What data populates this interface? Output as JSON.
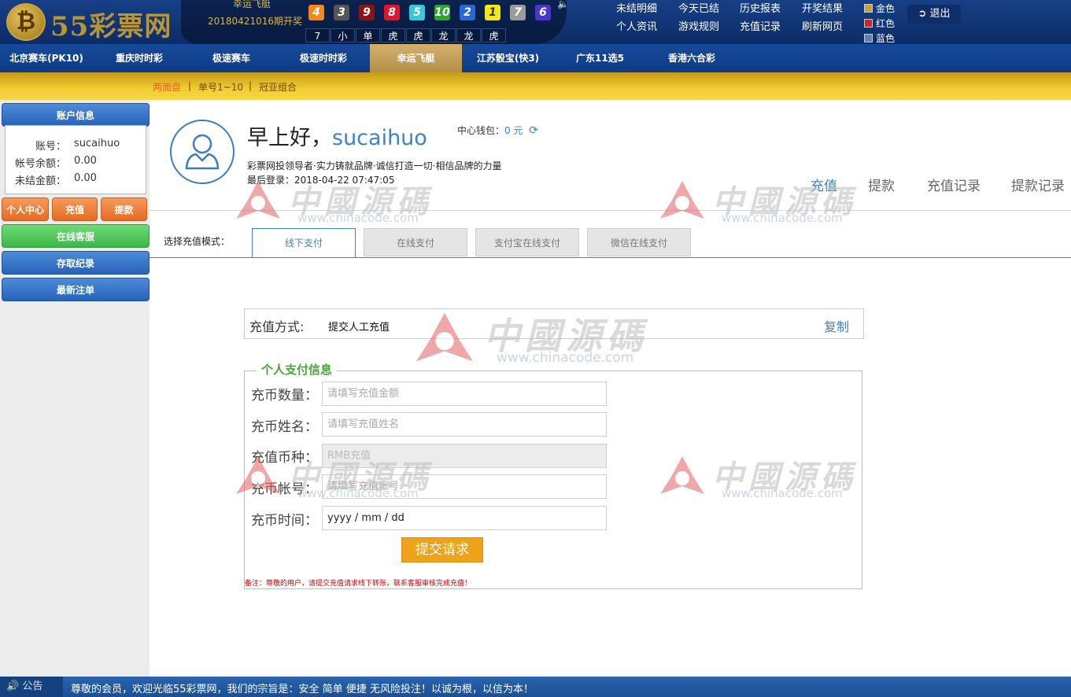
{
  "brand": {
    "logo_text": "55彩票网",
    "coin_glyph": "₿"
  },
  "lottery": {
    "game_name": "幸运飞艇",
    "period": "20180421016期开奖",
    "balls": [
      {
        "n": "4",
        "color": "#f08a1c"
      },
      {
        "n": "3",
        "color": "#555555"
      },
      {
        "n": "9",
        "color": "#8b1515"
      },
      {
        "n": "8",
        "color": "#e0172a"
      },
      {
        "n": "5",
        "color": "#38c7d6"
      },
      {
        "n": "10",
        "color": "#2fa32f"
      },
      {
        "n": "2",
        "color": "#2469d6"
      },
      {
        "n": "1",
        "color": "#f2e61d"
      },
      {
        "n": "7",
        "color": "#9b9b9b"
      },
      {
        "n": "6",
        "color": "#4a34c9"
      }
    ],
    "attrs": [
      "7",
      "小",
      "单",
      "虎",
      "虎",
      "龙",
      "龙",
      "虎"
    ]
  },
  "top_links": {
    "unsettled": "未结明细",
    "today_settled": "今天已结",
    "history": "历史报表",
    "results": "开奖结果",
    "personal_news": "个人资讯",
    "game_rules": "游戏规则",
    "recharge_record": "充值记录",
    "refresh": "刷新网页"
  },
  "theme_legend": [
    {
      "label": "金色",
      "color": "#c9a23a"
    },
    {
      "label": "红色",
      "color": "#d4202a"
    },
    {
      "label": "蓝色",
      "color": "#5f7fb8"
    }
  ],
  "logout_label": "退出",
  "nav": [
    "北京赛车(PK10)",
    "重庆时时彩",
    "极速赛车",
    "极速时时彩",
    "幸运飞艇",
    "江苏骰宝(快3)",
    "广东11选5",
    "香港六合彩"
  ],
  "subnav": [
    "两面盘",
    "单号1~10",
    "冠亚组合"
  ],
  "sidebar": {
    "account_info": "账户信息",
    "account_label": "账号：",
    "account_value": "sucaihuo",
    "balance_label": "帐号余额：",
    "balance_value": "0.00",
    "unsettled_label": "未结金额：",
    "unsettled_value": "0.00",
    "personal_center": "个人中心",
    "recharge": "充值",
    "withdraw": "提款",
    "online_service": "在线客服",
    "deposit_record": "存取纪录",
    "latest_bets": "最新注单"
  },
  "profile": {
    "greeting": "早上好，",
    "username": "sucaihuo",
    "wallet_label": "中心钱包：",
    "wallet_value": "0 元",
    "slogan": "彩票网投领导者·实力铸就品牌·诚信打造一切·相信品牌的力量",
    "last_login": "最后登录：2018-04-22 07:47:05"
  },
  "right_tabs": [
    "充值",
    "提款",
    "充值记录",
    "提款记录"
  ],
  "pay_mode_label": "选择充值模式：",
  "pay_tabs": [
    "线下支付",
    "在线支付",
    "支付宝在线支付",
    "微信在线支付"
  ],
  "method": {
    "label": "充值方式:",
    "value": "提交人工充值",
    "copy": "复制"
  },
  "form": {
    "legend": "个人支付信息",
    "amount_label": "充币数量：",
    "amount_placeholder": "请填写充值金额",
    "name_label": "充币姓名：",
    "name_placeholder": "请填写充值姓名",
    "currency_label": "充值币种：",
    "currency_value": "RMB充值",
    "account_label": "充币帐号：",
    "account_placeholder": "请填写充值帐号",
    "time_label": "充币时间：",
    "time_value": "yyyy / mm / dd",
    "submit": "提交请求",
    "note": "备注：尊敬的用户，请提交充值请求线下转账，联系客服审核完成充值！"
  },
  "watermark": {
    "text": "中國源碼",
    "url": "www.chinacode.com"
  },
  "footer": {
    "label": "公告",
    "message": "尊敬的会员，欢迎光临55彩票网，我们的宗旨是：安全 简单 便捷 无风险投注！以诚为根，以信为本！"
  }
}
